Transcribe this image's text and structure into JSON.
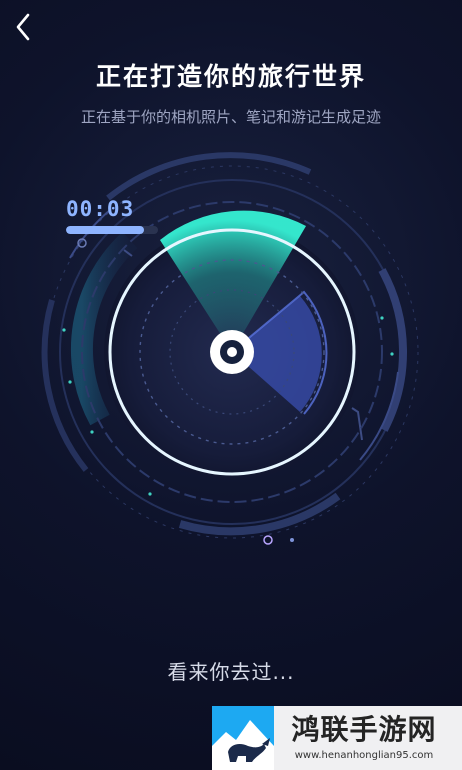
{
  "header": {
    "back_icon": "chevron-left-icon",
    "title": "正在打造你的旅行世界",
    "subtitle": "正在基于你的相机照片、笔记和游记生成足迹"
  },
  "timer": {
    "elapsed": "00:03",
    "progress_fraction": 0.85
  },
  "radar": {
    "icon": "radar-scan-icon",
    "accent_color": "#2ee3c8",
    "secondary_color": "#4b63c9"
  },
  "status": {
    "text": "看来你去过..."
  },
  "watermark": {
    "name": "鸿联手游网",
    "url": "www.henanhonglian95.com",
    "logo_icon": "bull-logo-icon"
  },
  "colors": {
    "background": "#0c1026",
    "timer_blue": "#8eb4ff",
    "text_muted": "#9ea5c2"
  }
}
